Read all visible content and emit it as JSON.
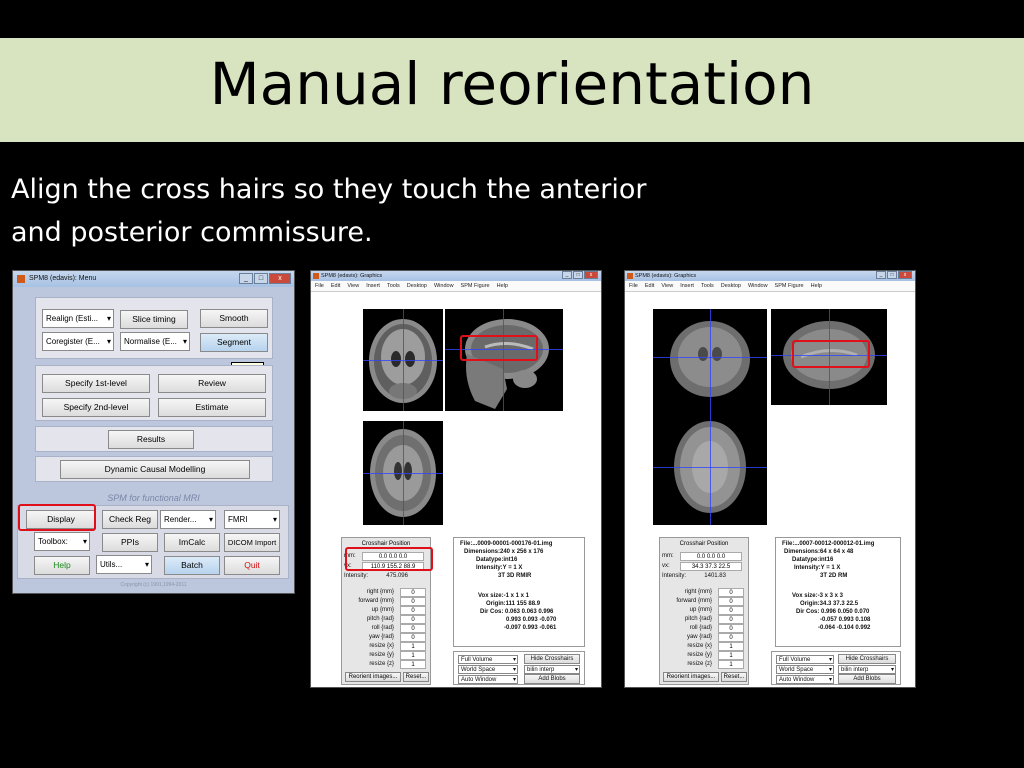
{
  "slide": {
    "title": "Manual reorientation",
    "body_line1": "Align the cross hairs so they touch the anterior",
    "body_line2": "and posterior commissure."
  },
  "menu_window": {
    "title": "SPM8 (edavis): Menu",
    "spatial": {
      "realign": "Realign (Esti...",
      "slice_timing": "Slice timing",
      "smooth": "Smooth",
      "coregister": "Coregister (E...",
      "normalise": "Normalise (E...",
      "segment": "Segment",
      "tooltip": "segment"
    },
    "model": {
      "specify_1st": "Specify 1st-level",
      "review": "Review",
      "specify_2nd": "Specify 2nd-level",
      "estimate": "Estimate"
    },
    "results": "Results",
    "dcm": "Dynamic Causal Modelling",
    "spm_for": "SPM for functional MRI",
    "tools": {
      "display": "Display",
      "check_reg": "Check Reg",
      "render": "Render...",
      "fmri": "FMRI",
      "toolbox": "Toolbox:",
      "ppis": "PPIs",
      "imcalc": "ImCalc",
      "dicom_import": "DICOM Import",
      "help": "Help",
      "utils": "Utils...",
      "batch": "Batch",
      "quit": "Quit"
    },
    "copyright": "Copyright (c) 1991,1994-2011"
  },
  "gfx_left": {
    "title": "SPM8 (edavis): Graphics",
    "menu": [
      "File",
      "Edit",
      "View",
      "Insert",
      "Tools",
      "Desktop",
      "Window",
      "SPM Figure",
      "Help"
    ],
    "crosshair_title": "Crosshair Position",
    "mm_label": "mm:",
    "mm_value": "0.0 0.0 0.0",
    "vx_label": "vx:",
    "vx_value": "110.9 155.2 88.9",
    "intensity_label": "Intensity:",
    "intensity_value": "475.096",
    "params": [
      {
        "label": "right  {mm}",
        "value": "0"
      },
      {
        "label": "forward  {mm}",
        "value": "0"
      },
      {
        "label": "up  {mm}",
        "value": "0"
      },
      {
        "label": "pitch  {rad}",
        "value": "0"
      },
      {
        "label": "roll  {rad}",
        "value": "0"
      },
      {
        "label": "yaw  {rad}",
        "value": "0"
      },
      {
        "label": "resize  {x}",
        "value": "1"
      },
      {
        "label": "resize  {y}",
        "value": "1"
      },
      {
        "label": "resize  {z}",
        "value": "1"
      }
    ],
    "reorient": "Reorient images...",
    "reset": "Reset...",
    "info": {
      "file": "File:...0009-00001-000176-01.img",
      "dimensions": "Dimensions:240 x 256 x 176",
      "datatype": "Datatype:int16",
      "intensity": "Intensity:Y = 1 X",
      "desc": "3T 3D RMIR",
      "voxsize": "Vox size:-1 x 1 x 1",
      "origin": "Origin:111 155 88.9",
      "dircos1": "Dir Cos: 0.063  0.063  0.996",
      "dircos2": "0.993  0.093 -0.070",
      "dircos3": "-0.097  0.993 -0.061"
    },
    "full_volume": "Full Volume",
    "world_space": "World Space",
    "auto_window": "Auto Window",
    "hide_crosshairs": "Hide Crosshairs",
    "interp": "bilin interp",
    "add_blobs": "Add Blobs"
  },
  "gfx_right": {
    "title": "SPM8 (edavis): Graphics",
    "menu": [
      "File",
      "Edit",
      "View",
      "Insert",
      "Tools",
      "Desktop",
      "Window",
      "SPM Figure",
      "Help"
    ],
    "crosshair_title": "Crosshair Position",
    "mm_label": "mm:",
    "mm_value": "0.0 0.0 0.0",
    "vx_label": "vx:",
    "vx_value": "34.3 37.3 22.5",
    "intensity_label": "Intensity:",
    "intensity_value": "1401.83",
    "params": [
      {
        "label": "right  {mm}",
        "value": "0"
      },
      {
        "label": "forward  {mm}",
        "value": "0"
      },
      {
        "label": "up  {mm}",
        "value": "0"
      },
      {
        "label": "pitch  {rad}",
        "value": "0"
      },
      {
        "label": "roll  {rad}",
        "value": "0"
      },
      {
        "label": "yaw  {rad}",
        "value": "0"
      },
      {
        "label": "resize  {x}",
        "value": "1"
      },
      {
        "label": "resize  {y}",
        "value": "1"
      },
      {
        "label": "resize  {z}",
        "value": "1"
      }
    ],
    "reorient": "Reorient images...",
    "reset": "Reset...",
    "info": {
      "file": "File:...0007-00012-000012-01.img",
      "dimensions": "Dimensions:64 x 64 x 48",
      "datatype": "Datatype:int16",
      "intensity": "Intensity:Y = 1 X",
      "desc": "3T 2D RM",
      "voxsize": "Vox size:-3 x 3 x 3",
      "origin": "Origin:34.3 37.3 22.5",
      "dircos1": "Dir Cos: 0.996  0.050  0.070",
      "dircos2": "-0.057  0.993  0.108",
      "dircos3": "-0.064 -0.104  0.992"
    },
    "full_volume": "Full Volume",
    "world_space": "World Space",
    "auto_window": "Auto Window",
    "hide_crosshairs": "Hide Crosshairs",
    "interp": "bilin interp",
    "add_blobs": "Add Blobs"
  },
  "colors": {
    "title_band": "#d8e4bf",
    "highlight": "#e0101a",
    "crosshair": "#3344ff"
  }
}
